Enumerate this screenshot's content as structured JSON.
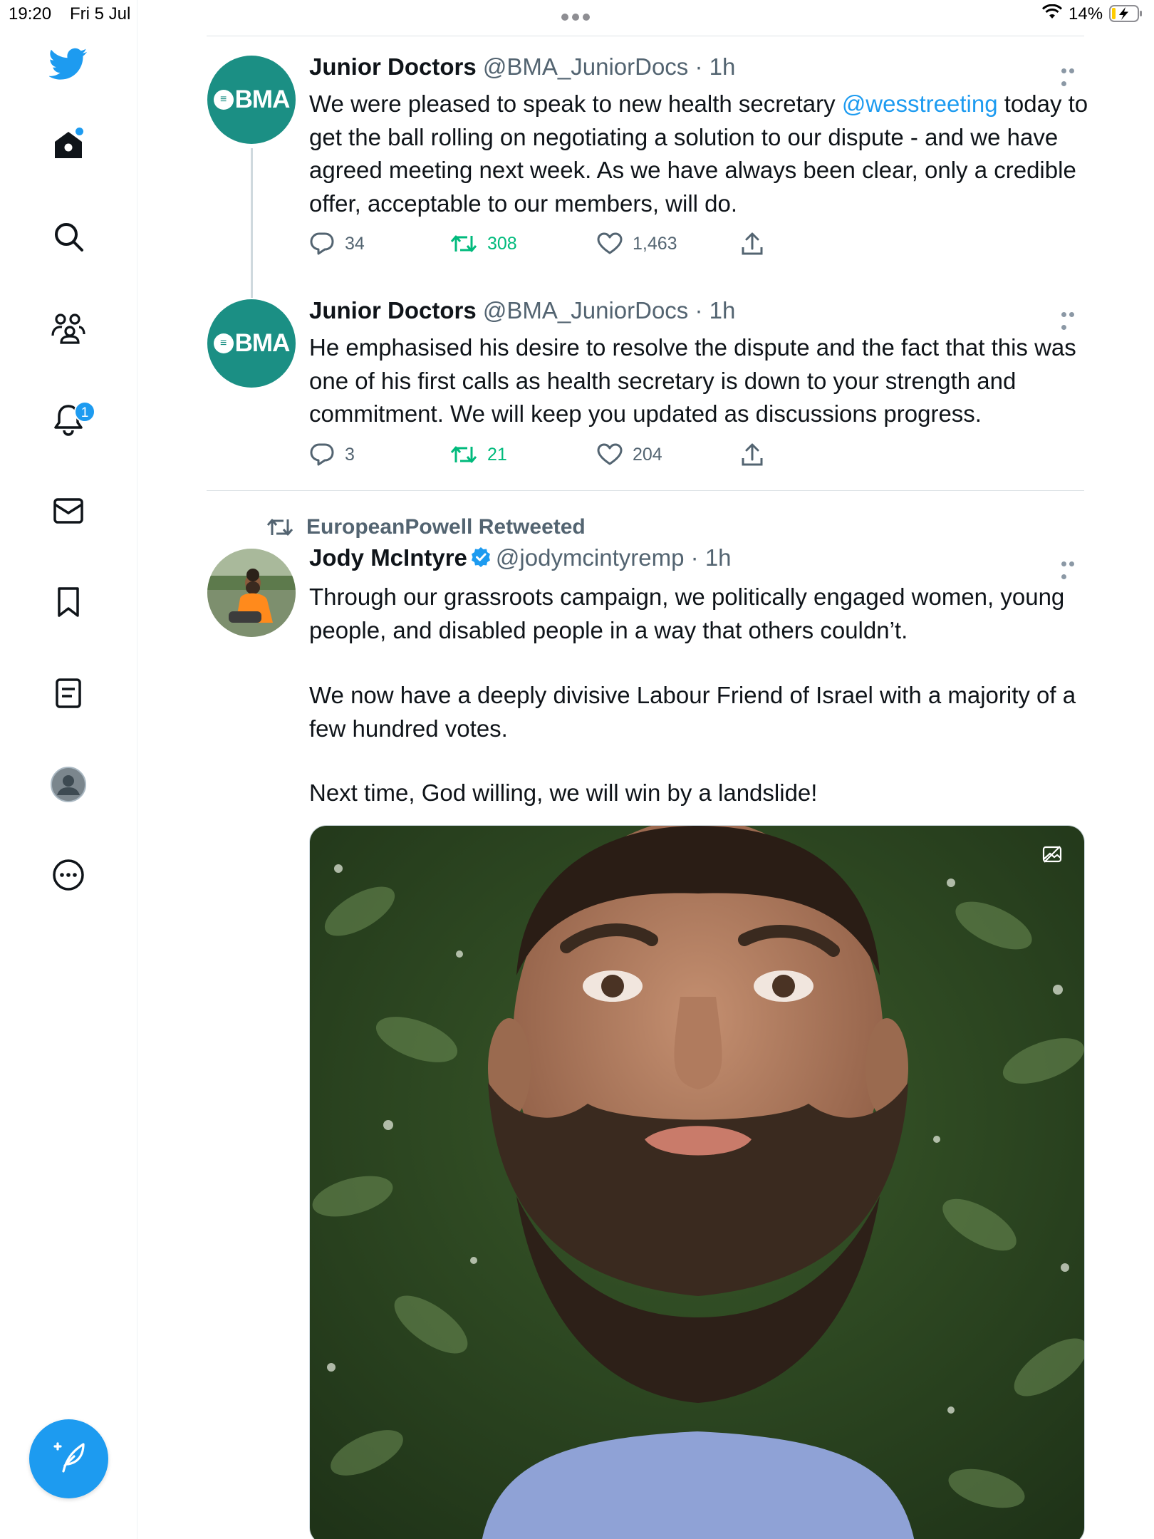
{
  "status_bar": {
    "time": "19:20",
    "date": "Fri 5 Jul",
    "battery_percent": "14%",
    "battery_level": 0.14
  },
  "sidebar": {
    "items": [
      {
        "icon": "twitter-bird-icon"
      },
      {
        "icon": "home-icon",
        "unread_dot": true
      },
      {
        "icon": "search-icon"
      },
      {
        "icon": "communities-icon"
      },
      {
        "icon": "notifications-bell-icon",
        "badge": "1"
      },
      {
        "icon": "messages-envelope-icon"
      },
      {
        "icon": "bookmark-icon"
      },
      {
        "icon": "lists-icon"
      },
      {
        "icon": "profile-avatar-icon"
      },
      {
        "icon": "more-options-icon"
      }
    ],
    "compose_icon": "compose-feather-icon"
  },
  "timeline": {
    "thread": [
      {
        "avatar_text": "BMA",
        "avatar_mark": "≡",
        "name": "Junior Doctors",
        "handle": "@BMA_JuniorDocs",
        "time": "· 1h",
        "text_before_mention": "We were pleased to speak to new health secretary ",
        "mention": "@wesstreeting",
        "text_after_mention": " today to get the ball rolling on negotiating a solution to our dispute - and we have agreed meeting next week. As we have always been clear, only a credible offer, acceptable to our members, will do.",
        "replies": "34",
        "retweets": "308",
        "likes": "1,463"
      },
      {
        "avatar_text": "BMA",
        "avatar_mark": "≡",
        "name": "Junior Doctors",
        "handle": "@BMA_JuniorDocs",
        "time": "· 1h",
        "text": "He emphasised his desire to resolve the dispute and the fact that this was one of his first calls as health secretary is down to your strength and commitment. We will keep you updated as discussions progress.",
        "replies": "3",
        "retweets": "21",
        "likes": "204"
      }
    ],
    "retweet": {
      "retweeted_by": "EuropeanPowell Retweeted",
      "name": "Jody McIntyre",
      "verified": true,
      "handle": "@jodymcintyremp",
      "time": "· 1h",
      "paragraphs": [
        "Through our grassroots campaign, we politically engaged women, young people, and disabled people in a way that others couldn’t.",
        "We now have a deeply divisive Labour Friend of Israel with a majority of a few hundred votes.",
        "Next time, God willing, we will win by a landslide!"
      ]
    }
  },
  "colors": {
    "accent": "#1d9bf0",
    "retweet_green": "#00ba7c",
    "bma_teal": "#1b8f84",
    "secondary_text": "#536471"
  }
}
